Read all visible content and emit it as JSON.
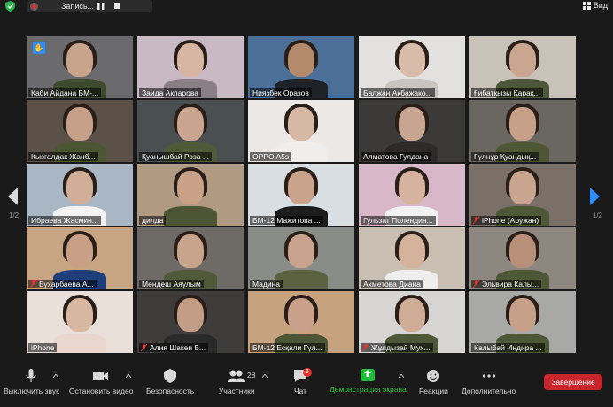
{
  "topbar": {
    "recording_label": "Запись...",
    "view_label": "Вид"
  },
  "pagination": {
    "left": "1/2",
    "right": "1/2"
  },
  "participants": [
    {
      "name": "Қаби Айдана БМ-...",
      "bg": "#6b6a6c",
      "skin": "#c9a48c",
      "top": "#3d4a2e",
      "raised_hand": true
    },
    {
      "name": "Заида Акпарова",
      "bg": "#c9b9c4",
      "skin": "#d6b6a2",
      "top": "#8a7f85"
    },
    {
      "name": "Ниязбек Оразов",
      "bg": "#4c6f98",
      "skin": "#b38a6c",
      "top": "#1f2228",
      "active": true
    },
    {
      "name": "Балжан Акбажако...",
      "bg": "#e3e1df",
      "skin": "#d8bca9",
      "top": "#c7c4c2"
    },
    {
      "name": "Ғибатқызы Қарақ...",
      "bg": "#c8c2b8",
      "skin": "#caa590",
      "top": "#4c5638"
    },
    {
      "name": "Кызгалдак Жанб...",
      "bg": "#5c5148",
      "skin": "#c7a08a",
      "top": "#4d5633"
    },
    {
      "name": "Қуанышбай Роза ...",
      "bg": "#4a4f52",
      "skin": "#c9a48e",
      "top": "#4f5a39"
    },
    {
      "name": "OPPO A5s",
      "bg": "#ebe8e6",
      "skin": "#d7b8a4",
      "top": "#f0eeec"
    },
    {
      "name": "Алматова Гулдана",
      "bg": "#3c3a38",
      "skin": "#c8a591",
      "top": "#2d2b2a"
    },
    {
      "name": "Гүлнұр Қуандық...",
      "bg": "#6a6660",
      "skin": "#c6a088",
      "top": "#4f5636"
    },
    {
      "name": "Ибраева Жасмин...",
      "bg": "#a9b6c4",
      "skin": "#d1ae98",
      "top": "#f2f2f2"
    },
    {
      "name": "дилда",
      "bg": "#b19a82",
      "skin": "#c9a187",
      "top": "#4c5634"
    },
    {
      "name": "БМ-12 Мажитова ...",
      "bg": "#d9dee3",
      "skin": "#caa38c",
      "top": "#1c1c1c"
    },
    {
      "name": "Гульзат Полендин...",
      "bg": "#d8b8c8",
      "skin": "#d5b39e",
      "top": "#f1f1f1"
    },
    {
      "name": "iPhone (Аружан)",
      "bg": "#7a7068",
      "skin": "#c9a48e",
      "top": "#4f5836",
      "muted": true
    },
    {
      "name": "Бухарбаева А...",
      "bg": "#c7a583",
      "skin": "#c99f86",
      "top": "#1f3f7a",
      "muted": true
    },
    {
      "name": "Мендеш Аяулым",
      "bg": "#6e6a66",
      "skin": "#c8a48c",
      "top": "#505a3a"
    },
    {
      "name": "Мадина",
      "bg": "#8a8c87",
      "skin": "#c9a38d",
      "top": "#5c6240"
    },
    {
      "name": "Ахметова Диана",
      "bg": "#c9bfb2",
      "skin": "#d4b29c",
      "top": "#eeeeee"
    },
    {
      "name": "Эльвира Калы...",
      "bg": "#8e877f",
      "skin": "#b89079",
      "top": "#4e5736",
      "muted": true
    },
    {
      "name": "iPhone",
      "bg": "#e8dfd9",
      "skin": "#d8b7a0",
      "top": "#e9d6cf"
    },
    {
      "name": "Алия Шакен Б...",
      "bg": "#3f3d3c",
      "skin": "#c29c85",
      "top": "#2a2a2a",
      "muted": true
    },
    {
      "name": "БМ-12 Есқали Гүл...",
      "bg": "#c6a27e",
      "skin": "#c9a08a",
      "top": "#4c5634"
    },
    {
      "name": "Жұлдызай Мух...",
      "bg": "#d7d5d4",
      "skin": "#ceac96",
      "top": "#4e5838",
      "muted": true
    },
    {
      "name": "Калыбай Индира ...",
      "bg": "#a8a8a6",
      "skin": "#c7a08a",
      "top": "#4d5736"
    }
  ],
  "toolbar": {
    "mute_label": "Выключить звук",
    "video_label": "Остановить видео",
    "security_label": "Безопасность",
    "participants_label": "Участники",
    "participants_count": "28",
    "chat_label": "Чат",
    "chat_badge": "6",
    "share_label": "Демонстрация экрана",
    "reactions_label": "Реакции",
    "more_label": "Дополнительно",
    "end_label": "Завершение"
  },
  "colors": {
    "active_speaker": "#b3d236",
    "share_green": "#1fbe3a",
    "end_red": "#c8252c",
    "hand_blue": "#2d8cff"
  }
}
